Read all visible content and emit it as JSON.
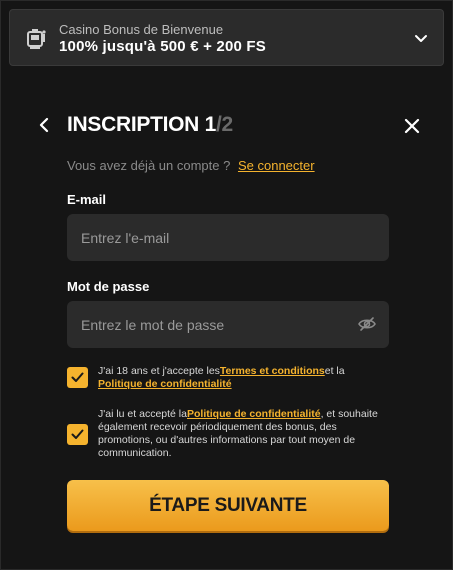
{
  "bonus": {
    "subtitle": "Casino Bonus de Bienvenue",
    "headline": "100% jusqu'à 500 € + 200 FS",
    "icon": "slot-machine-icon"
  },
  "header": {
    "title": "INSCRIPTION 1",
    "step": "/2"
  },
  "account": {
    "prompt": "Vous avez déjà un compte ?",
    "link": "Se connecter"
  },
  "email": {
    "label": "E-mail",
    "placeholder": "Entrez l'e-mail",
    "value": ""
  },
  "password": {
    "label": "Mot de passe",
    "placeholder": "Entrez le mot de passe",
    "value": ""
  },
  "consent1": {
    "checked": true,
    "text_before": "J'ai 18 ans et j'accepte les",
    "link1": "Termes et conditions",
    "text_mid": "et la",
    "link2": "Politique de confidentialité"
  },
  "consent2": {
    "checked": true,
    "text_before": "J'ai lu et accepté la",
    "link": "Politique de confidentialité",
    "text_after": ", et souhaite également recevoir périodiquement des bonus, des promotions, ou d'autres informations par tout moyen de communication."
  },
  "cta": {
    "label": "ÉTAPE SUIVANTE"
  },
  "colors": {
    "accent": "#f5b32e",
    "background": "#151515",
    "field": "#2b2b2b"
  }
}
